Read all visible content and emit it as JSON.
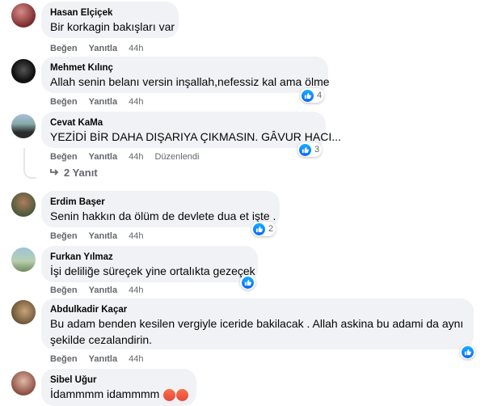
{
  "actions": {
    "like": "Beğen",
    "reply": "Yanıtla"
  },
  "comments": [
    {
      "name": "Hasan Elçiçek",
      "text": "Bir korkagin bakışları var",
      "time": "44h",
      "reactions": ""
    },
    {
      "name": "Mehmet Kılınç",
      "text": "Allah senin belanı versin inşallah,nefessiz kal ama ölme",
      "time": "44h",
      "reactions": "4"
    },
    {
      "name": "Cevat KaMa",
      "text": "YEZİDİ BİR DAHA DIŞARIYA ÇIKMASIN. GÂVUR HACI...",
      "time": "44h",
      "edited": "Düzenlendi",
      "reactions": "3",
      "replies": "2 Yanıt"
    },
    {
      "name": "Erdim Başer",
      "text": "Senin hakkın da ölüm de devlete dua et işte .",
      "time": "44h",
      "reactions": "2"
    },
    {
      "name": "Furkan Yılmaz",
      "text": "İşi deliliğe süreçek yine ortalıkta gezeçek",
      "time": "44h",
      "reactions": ""
    },
    {
      "name": "Abdulkadir Kaçar",
      "text_line1": "Bu adam benden kesilen vergiyle iceride bakilacak . Allah askina bu adami da aynı",
      "text_line2": "şekilde cezalandirin.",
      "time": "44h",
      "reactions": ""
    },
    {
      "name": "Sibel Uğur",
      "text": "İdammmm idammmm",
      "reactions": ""
    }
  ],
  "colors": {
    "bubble": "#f0f2f5",
    "meta": "#65676b",
    "like_blue": "#0866ff"
  }
}
